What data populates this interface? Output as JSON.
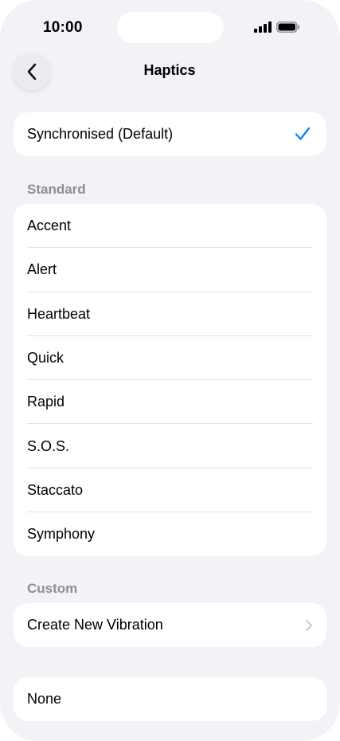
{
  "status_bar": {
    "time": "10:00",
    "icons": [
      "cellular-signal-icon",
      "battery-icon"
    ]
  },
  "nav": {
    "title": "Haptics",
    "back_icon": "chevron-left-icon"
  },
  "default_option": {
    "label": "Synchronised (Default)",
    "selected": true,
    "check_color": "#0a84ff"
  },
  "standard": {
    "header": "Standard",
    "items": [
      {
        "label": "Accent"
      },
      {
        "label": "Alert"
      },
      {
        "label": "Heartbeat"
      },
      {
        "label": "Quick"
      },
      {
        "label": "Rapid"
      },
      {
        "label": "S.O.S."
      },
      {
        "label": "Staccato"
      },
      {
        "label": "Symphony"
      }
    ]
  },
  "custom": {
    "header": "Custom",
    "create_label": "Create New Vibration"
  },
  "none_option": {
    "label": "None"
  },
  "colors": {
    "background": "#f2f2f7",
    "accent": "#0a84ff",
    "secondary_text": "#8e8e93"
  }
}
